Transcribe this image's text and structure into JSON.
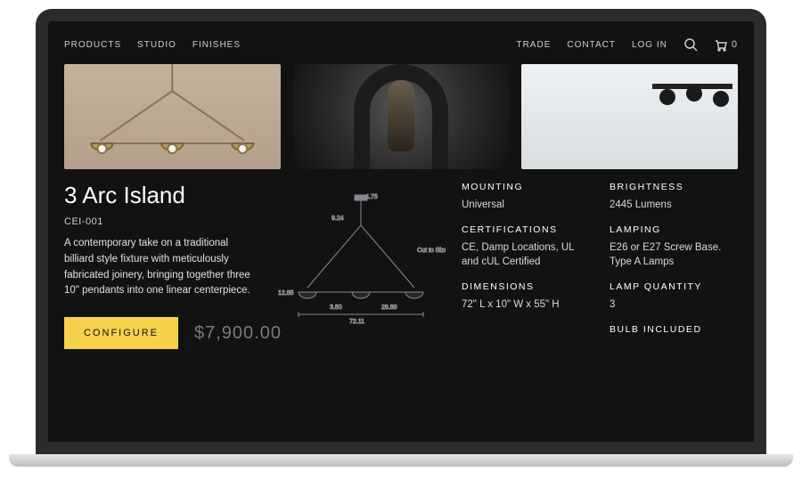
{
  "nav": {
    "left": [
      "PRODUCTS",
      "STUDIO",
      "FINISHES"
    ],
    "right": [
      "TRADE",
      "CONTACT",
      "LOG IN"
    ],
    "cart_count": "0"
  },
  "product": {
    "title": "3 Arc Island",
    "sku": "CEI-001",
    "description": "A contemporary take on a traditional billiard style fixture with meticulously fabricated joinery, bringing together three 10\" pendants into one linear centerpiece.",
    "cta": "CONFIGURE",
    "price": "$7,900.00"
  },
  "diagram": {
    "d1": "4.75",
    "d2": "9.24",
    "d3": "12.85",
    "d4": "3.50",
    "d5": "28.89",
    "d6": "72.11",
    "note": "Cut to Size"
  },
  "specs": {
    "mounting": {
      "label": "MOUNTING",
      "value": "Universal"
    },
    "brightness": {
      "label": "BRIGHTNESS",
      "value": "2445 Lumens"
    },
    "certifications": {
      "label": "CERTIFICATIONS",
      "value": "CE, Damp Locations, UL and cUL Certified"
    },
    "lamping": {
      "label": "LAMPING",
      "value": "E26 or E27 Screw Base. Type A Lamps"
    },
    "dimensions": {
      "label": "DIMENSIONS",
      "value": "72\" L x 10\" W x 55\" H"
    },
    "lamp_quantity": {
      "label": "LAMP QUANTITY",
      "value": "3"
    },
    "bulb": {
      "label": "BULB INCLUDED",
      "value": ""
    }
  }
}
